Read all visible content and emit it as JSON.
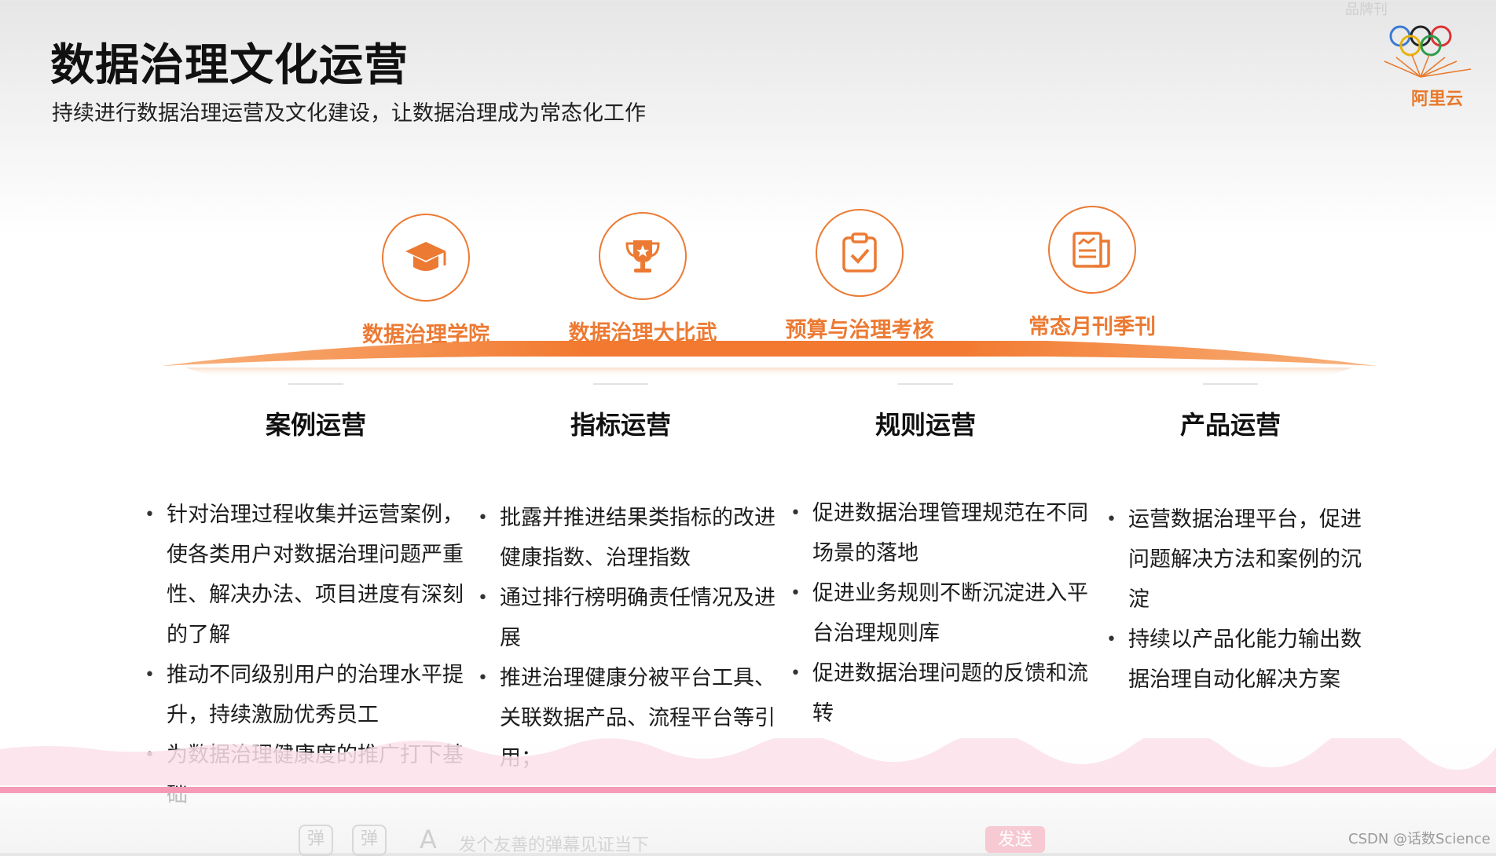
{
  "title": "数据治理文化运营",
  "subtitle": "持续进行数据治理运营及文化建设，让数据治理成为常态化工作",
  "logo": {
    "text": "阿里云",
    "top_caption": "品牌刊",
    "brand_color": "#e8792b"
  },
  "accent_color": "#ec7a33",
  "features": [
    {
      "label": "数据治理学院",
      "icon": "graduation-cap-icon"
    },
    {
      "label": "数据治理大比武",
      "icon": "trophy-icon"
    },
    {
      "label": "预算与治理考核",
      "icon": "clipboard-check-icon"
    },
    {
      "label": "常态月刊季刊",
      "icon": "document-icon"
    }
  ],
  "columns": [
    {
      "title": "案例运营",
      "bullets": [
        "针对治理过程收集并运营案例，使各类用户对数据治理问题严重性、解决办法、项目进度有深刻的了解",
        "推动不同级别用户的治理水平提升，持续激励优秀员工",
        "为数据治理健康度的推广打下基础"
      ]
    },
    {
      "title": "指标运营",
      "bullets": [
        "批露并推进结果类指标的改进健康指数、治理指数",
        "通过排行榜明确责任情况及进展",
        "推进治理健康分被平台工具、关联数据产品、流程平台等引用；"
      ]
    },
    {
      "title": "规则运营",
      "bullets": [
        "促进数据治理管理规范在不同场景的落地",
        "促进业务规则不断沉淀进入平台治理规则库",
        "促进数据治理问题的反馈和流转"
      ]
    },
    {
      "title": "产品运营",
      "bullets": [
        "运营数据治理平台，促进问题解决方法和案例的沉淀",
        "持续以产品化能力输出数据治理自动化解决方案"
      ]
    }
  ],
  "chat": {
    "placeholder": "发个友善的弹幕见证当下",
    "send_label": "发送",
    "font_icon_label": "A"
  },
  "watermark": "CSDN @话数Science"
}
